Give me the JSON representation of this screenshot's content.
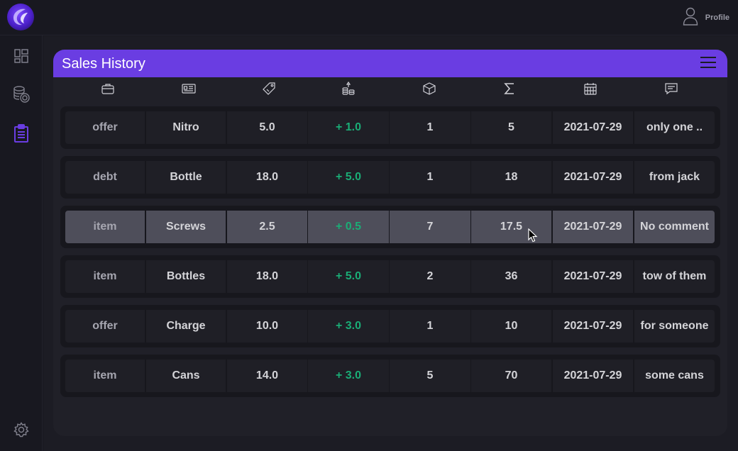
{
  "topbar": {
    "logo_icon": "phoenix-logo",
    "profile_label": "Profile",
    "profile_icon": "user-icon"
  },
  "sidebar": {
    "items": [
      {
        "name": "dashboard",
        "icon": "dashboard-icon",
        "active": false
      },
      {
        "name": "coins",
        "icon": "coins-icon",
        "active": false
      },
      {
        "name": "clipboard",
        "icon": "clipboard-icon",
        "active": true
      }
    ],
    "settings_icon": "gear-icon"
  },
  "colors": {
    "accent": "#6a3de2",
    "active_icon": "#6a3de2",
    "green": "#1aad76",
    "background": "#17171f"
  },
  "card": {
    "title": "Sales History",
    "menu_icon": "hamburger-icon",
    "columns": [
      {
        "key": "type",
        "icon": "briefcase-icon"
      },
      {
        "key": "name",
        "icon": "id-card-icon"
      },
      {
        "key": "price",
        "icon": "tag-icon"
      },
      {
        "key": "profit",
        "icon": "coins-icon"
      },
      {
        "key": "quantity",
        "icon": "box-icon"
      },
      {
        "key": "total",
        "icon": "sigma-icon"
      },
      {
        "key": "date",
        "icon": "calendar-icon"
      },
      {
        "key": "comment",
        "icon": "comment-icon"
      }
    ],
    "rows": [
      {
        "type": "offer",
        "name": "Nitro",
        "price": "5.0",
        "profit": "+ 1.0",
        "quantity": "1",
        "total": "5",
        "date": "2021-07-29",
        "comment": "only one .."
      },
      {
        "type": "debt",
        "name": "Bottle",
        "price": "18.0",
        "profit": "+ 5.0",
        "quantity": "1",
        "total": "18",
        "date": "2021-07-29",
        "comment": "from jack"
      },
      {
        "type": "item",
        "name": "Screws",
        "price": "2.5",
        "profit": "+ 0.5",
        "quantity": "7",
        "total": "17.5",
        "date": "2021-07-29",
        "comment": "No comment"
      },
      {
        "type": "item",
        "name": "Bottles",
        "price": "18.0",
        "profit": "+ 5.0",
        "quantity": "2",
        "total": "36",
        "date": "2021-07-29",
        "comment": "tow of them"
      },
      {
        "type": "offer",
        "name": "Charge",
        "price": "10.0",
        "profit": "+ 3.0",
        "quantity": "1",
        "total": "10",
        "date": "2021-07-29",
        "comment": "for someone"
      },
      {
        "type": "item",
        "name": "Cans",
        "price": "14.0",
        "profit": "+ 3.0",
        "quantity": "5",
        "total": "70",
        "date": "2021-07-29",
        "comment": "some cans"
      }
    ]
  }
}
